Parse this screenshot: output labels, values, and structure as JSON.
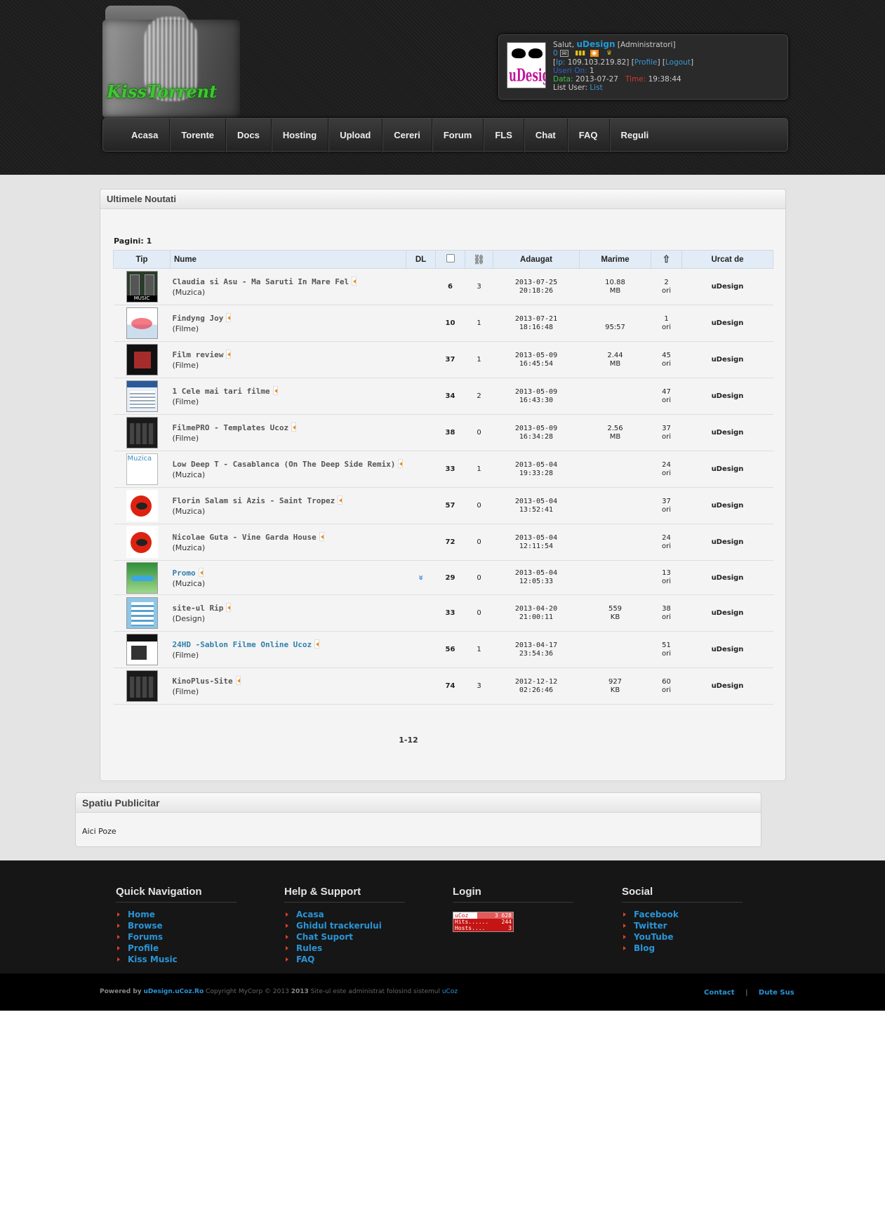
{
  "header": {
    "logo_text": "KissTorrent",
    "user": {
      "greeting": "Salut,",
      "name": "uDesign",
      "role": "[Administratori]",
      "messages": "0",
      "ip_label": "Ip:",
      "ip": "109.103.219.82",
      "profile_link": "Profile",
      "logout_link": "Logout",
      "users_on_label": "Useri On:",
      "users_on": "1",
      "date_label": "Data:",
      "date": "2013-07-27",
      "time_label": "Time:",
      "time": "19:38:44",
      "list_label": "List User:",
      "list_link": "List",
      "avatar_text": "uDesign"
    },
    "nav": [
      "Acasa",
      "Torente",
      "Docs",
      "Hosting",
      "Upload",
      "Cereri",
      "Forum",
      "FLS",
      "Chat",
      "FAQ",
      "Reguli"
    ]
  },
  "news": {
    "title": "Ultimele Noutati",
    "pagini": "Pagini: 1",
    "columns": [
      "Tip",
      "Nume",
      "DL",
      "Adaugat",
      "Marime",
      "Urcat de"
    ],
    "rows": [
      {
        "name": "Claudia si Asu - Ma Saruti In Mare Fel",
        "cat": "(Muzica)",
        "dl": "",
        "c1": "6",
        "c2": "3",
        "date": "2013-07-25",
        "time": "20:18:26",
        "size": "10.88",
        "unit": "MB",
        "dls": "2",
        "ori": "ori",
        "user": "uDesign",
        "thumb": "music",
        "link": false
      },
      {
        "name": "Findyng Joy",
        "cat": "(Filme)",
        "dl": "",
        "c1": "10",
        "c2": "1",
        "date": "2013-07-21",
        "time": "18:16:48",
        "size": "",
        "unit": "95:57",
        "dls": "1",
        "ori": "ori",
        "user": "uDesign",
        "thumb": "poster",
        "link": false
      },
      {
        "name": "Film review",
        "cat": "(Filme)",
        "dl": "",
        "c1": "37",
        "c2": "1",
        "date": "2013-05-09",
        "time": "16:45:54",
        "size": "2.44",
        "unit": "MB",
        "dls": "45",
        "ori": "ori",
        "user": "uDesign",
        "thumb": "dark",
        "link": false
      },
      {
        "name": "1 Cele mai tari filme",
        "cat": "(Filme)",
        "dl": "",
        "c1": "34",
        "c2": "2",
        "date": "2013-05-09",
        "time": "16:43:30",
        "size": "",
        "unit": "",
        "dls": "47",
        "ori": "ori",
        "user": "uDesign",
        "thumb": "site-blue",
        "link": false
      },
      {
        "name": "FilmePRO - Templates Ucoz",
        "cat": "(Filme)",
        "dl": "",
        "c1": "38",
        "c2": "0",
        "date": "2013-05-09",
        "time": "16:34:28",
        "size": "2.56",
        "unit": "MB",
        "dls": "37",
        "ori": "ori",
        "user": "uDesign",
        "thumb": "site-dark",
        "link": false
      },
      {
        "name": "Low Deep T - Casablanca (On The Deep Side Remix)",
        "cat": "(Muzica)",
        "dl": "",
        "c1": "33",
        "c2": "1",
        "date": "2013-05-04",
        "time": "19:33:28",
        "size": "",
        "unit": "",
        "dls": "24",
        "ori": "ori",
        "user": "uDesign",
        "thumb": "text",
        "thumb_text": "Muzica",
        "link": false
      },
      {
        "name": "Florin Salam si Azis - Saint Tropez",
        "cat": "(Muzica)",
        "dl": "",
        "c1": "57",
        "c2": "0",
        "date": "2013-05-04",
        "time": "13:52:41",
        "size": "",
        "unit": "",
        "dls": "37",
        "ori": "ori",
        "user": "uDesign",
        "thumb": "dj",
        "link": false
      },
      {
        "name": "Nicolae Guta - Vine Garda House",
        "cat": "(Muzica)",
        "dl": "",
        "c1": "72",
        "c2": "0",
        "date": "2013-05-04",
        "time": "12:11:54",
        "size": "",
        "unit": "",
        "dls": "24",
        "ori": "ori",
        "user": "uDesign",
        "thumb": "dj",
        "link": false
      },
      {
        "name": "Promo",
        "cat": "(Muzica)",
        "dl": "»",
        "c1": "29",
        "c2": "0",
        "date": "2013-05-04",
        "time": "12:05:33",
        "size": "",
        "unit": "",
        "dls": "13",
        "ori": "ori",
        "user": "uDesign",
        "thumb": "nature",
        "link": true
      },
      {
        "name": "site-ul Rip",
        "cat": "(Design)",
        "dl": "",
        "c1": "33",
        "c2": "0",
        "date": "2013-04-20",
        "time": "21:00:11",
        "size": "559",
        "unit": "KB",
        "dls": "38",
        "ori": "ori",
        "user": "uDesign",
        "thumb": "site-light",
        "link": false
      },
      {
        "name": "24HD -Sablon Filme Online Ucoz",
        "cat": "(Filme)",
        "dl": "",
        "c1": "56",
        "c2": "1",
        "date": "2013-04-17",
        "time": "23:54:36",
        "size": "",
        "unit": "",
        "dls": "51",
        "ori": "ori",
        "user": "uDesign",
        "thumb": "site-white",
        "link": true
      },
      {
        "name": "KinoPlus-Site",
        "cat": "(Filme)",
        "dl": "",
        "c1": "74",
        "c2": "3",
        "date": "2012-12-12",
        "time": "02:26:46",
        "size": "927",
        "unit": "KB",
        "dls": "60",
        "ori": "ori",
        "user": "uDesign",
        "thumb": "site-dark",
        "link": false
      }
    ],
    "pages": "1-12"
  },
  "ads": {
    "title": "Spatiu Publicitar",
    "body": "Aici Poze"
  },
  "footer": {
    "quick_nav": {
      "title": "Quick Navigation",
      "items": [
        "Home",
        "Browse",
        "Forums",
        "Profile",
        "Kiss Music"
      ]
    },
    "help": {
      "title": "Help & Support",
      "items": [
        "Acasa",
        "Ghidul trackerului",
        "Chat Suport",
        "Rules",
        "FAQ"
      ]
    },
    "login": {
      "title": "Login",
      "counter": {
        "brand": "uCoz",
        "total": "3 628",
        "hits_label": "Hits......",
        "hits": "244",
        "hosts_label": "Hosts....",
        "hosts": "3"
      }
    },
    "social": {
      "title": "Social",
      "items": [
        "Facebook",
        "Twitter",
        "YouTube",
        "Blog"
      ]
    }
  },
  "copyright": {
    "powered": "Powered by",
    "powered_link": "uDesign.uCoz.Ro",
    "text": "Copyright MyCorp © 2013",
    "year": "2013",
    "text2": "Site-ul este administrat folosind sistemul",
    "ucoz": "uCoz",
    "contact": "Contact",
    "sep": "|",
    "top": "Dute Sus"
  }
}
